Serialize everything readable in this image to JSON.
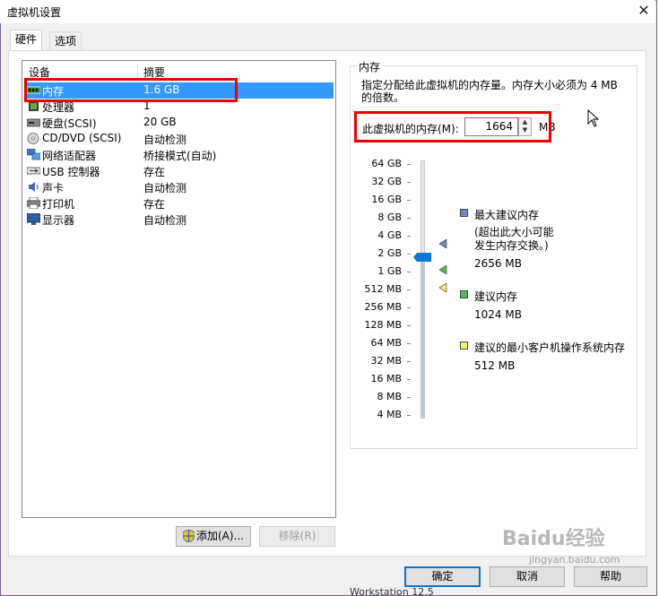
{
  "window": {
    "title": "虚拟机设置",
    "close_glyph": "✕"
  },
  "tabs": [
    {
      "label": "硬件",
      "active": true
    },
    {
      "label": "选项",
      "active": false
    }
  ],
  "devices": {
    "col_device": "设备",
    "col_summary": "摘要",
    "rows": [
      {
        "name": "内存",
        "summary": "1.6 GB",
        "icon": "memory-icon",
        "selected": true
      },
      {
        "name": "处理器",
        "summary": "1",
        "icon": "cpu-icon"
      },
      {
        "name": "硬盘(SCSI)",
        "summary": "20 GB",
        "icon": "hard-disk-icon"
      },
      {
        "name": "CD/DVD (SCSI)",
        "summary": "自动检测",
        "icon": "cd-dvd-icon"
      },
      {
        "name": "网络适配器",
        "summary": "桥接模式(自动)",
        "icon": "network-adapter-icon"
      },
      {
        "name": "USB 控制器",
        "summary": "存在",
        "icon": "usb-icon"
      },
      {
        "name": "声卡",
        "summary": "自动检测",
        "icon": "sound-card-icon"
      },
      {
        "name": "打印机",
        "summary": "存在",
        "icon": "printer-icon"
      },
      {
        "name": "显示器",
        "summary": "自动检测",
        "icon": "monitor-icon"
      }
    ],
    "add_label": "添加(A)...",
    "remove_label": "移除(R)"
  },
  "memory": {
    "group_title": "内存",
    "description": "指定分配给此虚拟机的内存量。内存大小必须为 4 MB 的倍数。",
    "field_label": "此虚拟机的内存(M):",
    "value": "1664",
    "unit": "MB",
    "scale_labels": [
      "64 GB",
      "32 GB",
      "16 GB",
      "8 GB",
      "4 GB",
      "2 GB",
      "1 GB",
      "512 MB",
      "256 MB",
      "128 MB",
      "64 MB",
      "32 MB",
      "16 MB",
      "8 MB",
      "4 MB"
    ],
    "legend": {
      "max": {
        "title": "最大建议内存",
        "note": "(超出此大小可能\n发生内存交换。)",
        "value": "2656 MB",
        "color": "#6a8cc7"
      },
      "rec": {
        "title": "建议内存",
        "value": "1024 MB",
        "color": "#4ec04e"
      },
      "min": {
        "title": "建议的最小客户机操作系统内存",
        "value": "512 MB",
        "color": "#f5f06a"
      }
    }
  },
  "footer": {
    "ok": "确定",
    "cancel": "取消",
    "help": "帮助"
  },
  "watermark": {
    "brand": "Baidu经验",
    "url": "jingyan.baidu.com"
  },
  "background_text": "Workstation 12.5"
}
